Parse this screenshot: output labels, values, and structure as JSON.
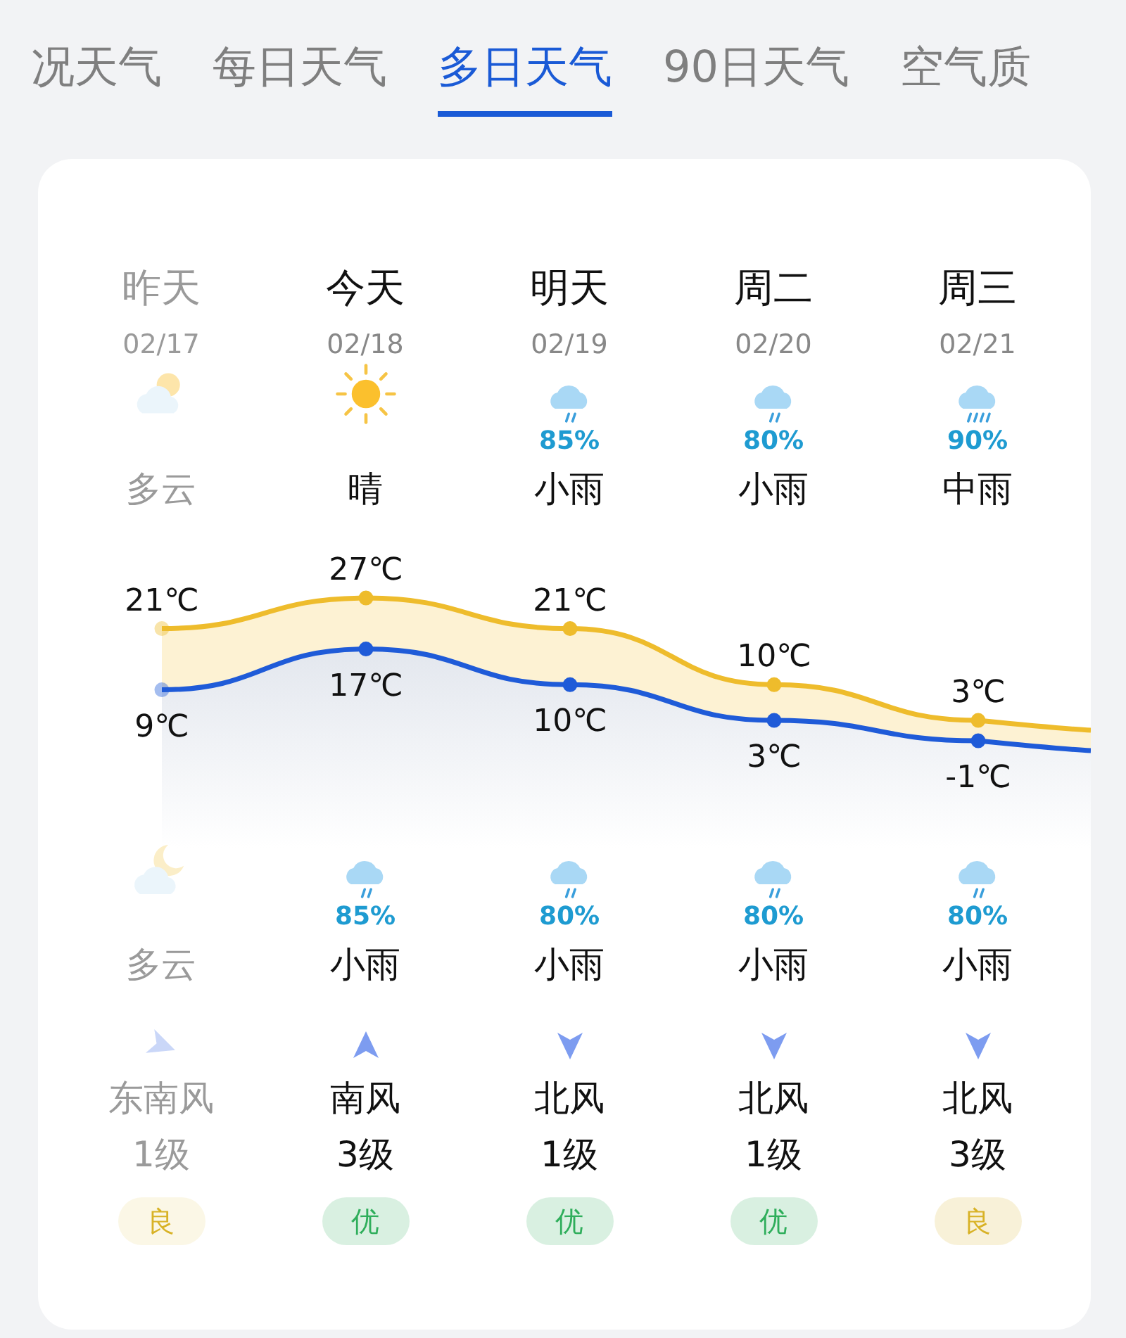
{
  "tabs": [
    {
      "label": "况天气",
      "selected": false
    },
    {
      "label": "每日天气",
      "selected": false
    },
    {
      "label": "多日天气",
      "selected": true
    },
    {
      "label": "90日天气",
      "selected": false
    },
    {
      "label": "空气质",
      "selected": false
    }
  ],
  "days": [
    {
      "day": "昨天",
      "date": "02/17",
      "past": true,
      "day_icon": {
        "kind": "partly_cloudy"
      },
      "day_cond": "多云",
      "night_icon": {
        "kind": "moon_cloud"
      },
      "night_cond": "多云",
      "wind_arrow": {
        "kind": "right"
      },
      "wind": "东南风",
      "wind_level": "1级",
      "aqi": {
        "label": "良",
        "color": "#d8b226"
      }
    },
    {
      "day": "今天",
      "date": "02/18",
      "past": false,
      "day_icon": {
        "kind": "sunny"
      },
      "day_cond": "晴",
      "night_icon": {
        "kind": "light_rain"
      },
      "night_precip": "85%",
      "night_cond": "小雨",
      "wind_arrow": {
        "kind": "up"
      },
      "wind": "南风",
      "wind_level": "3级",
      "aqi": {
        "label": "优",
        "color": "#2fae5b"
      }
    },
    {
      "day": "明天",
      "date": "02/19",
      "past": false,
      "day_icon": {
        "kind": "light_rain"
      },
      "day_precip": "85%",
      "day_cond": "小雨",
      "night_icon": {
        "kind": "light_rain"
      },
      "night_precip": "80%",
      "night_cond": "小雨",
      "wind_arrow": {
        "kind": "down"
      },
      "wind": "北风",
      "wind_level": "1级",
      "aqi": {
        "label": "优",
        "color": "#2fae5b"
      }
    },
    {
      "day": "周二",
      "date": "02/20",
      "past": false,
      "day_icon": {
        "kind": "light_rain"
      },
      "day_precip": "80%",
      "day_cond": "小雨",
      "night_icon": {
        "kind": "light_rain"
      },
      "night_precip": "80%",
      "night_cond": "小雨",
      "wind_arrow": {
        "kind": "down"
      },
      "wind": "北风",
      "wind_level": "1级",
      "aqi": {
        "label": "优",
        "color": "#2fae5b"
      }
    },
    {
      "day": "周三",
      "date": "02/21",
      "past": false,
      "day_icon": {
        "kind": "moderate_rain"
      },
      "day_precip": "90%",
      "day_cond": "中雨",
      "night_icon": {
        "kind": "light_rain"
      },
      "night_precip": "80%",
      "night_cond": "小雨",
      "wind_arrow": {
        "kind": "down"
      },
      "wind": "北风",
      "wind_level": "3级",
      "aqi": {
        "label": "良",
        "color": "#d8b226"
      }
    }
  ],
  "temperature": {
    "chart_data": {
      "type": "line",
      "categories": [
        null,
        null,
        null,
        null,
        null
      ],
      "series": [
        {
          "color": "#eebc2c",
          "marker": "circle",
          "values": [
            21,
            27,
            21,
            10,
            3
          ],
          "value_labels": [
            "21℃",
            "27℃",
            "21℃",
            "10℃",
            "3℃"
          ]
        },
        {
          "color": "#1f5bd8",
          "marker": "circle",
          "values": [
            9,
            17,
            10,
            3,
            -1
          ],
          "value_labels": [
            "9℃",
            "17℃",
            "10℃",
            "3℃",
            "-1℃"
          ]
        }
      ]
    }
  }
}
